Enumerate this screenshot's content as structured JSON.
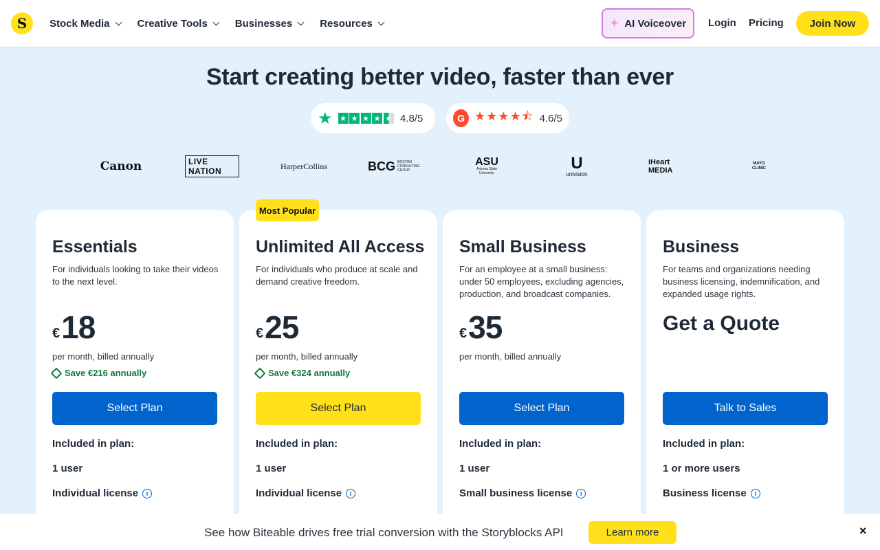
{
  "nav": {
    "logo": "S",
    "menu": [
      {
        "label": "Stock Media"
      },
      {
        "label": "Creative Tools"
      },
      {
        "label": "Businesses"
      },
      {
        "label": "Resources"
      }
    ],
    "ai_voiceover": "AI Voiceover",
    "login": "Login",
    "pricing": "Pricing",
    "join": "Join Now"
  },
  "hero": {
    "title": "Start creating better video, faster than ever",
    "trustpilot_score": "4.8/5",
    "g2_logo": "G",
    "g2_score": "4.6/5"
  },
  "logos": {
    "canon": "Canon",
    "livenation": "LIVE NATION",
    "harpercollins": "HarperCollins",
    "bcg": "BCG",
    "bcg_sub": "BOSTON CONSULTING GROUP",
    "asu": "ASU",
    "asu_sub": "Arizona State University",
    "univision_mark": "U",
    "univision": "univision",
    "iheart": "iHeart MEDIA",
    "mayo": "MAYO CLINIC"
  },
  "badge": "Most Popular",
  "plans": [
    {
      "name": "Essentials",
      "desc": "For individuals looking to take their videos to the next level.",
      "currency": "€",
      "amount": "18",
      "billing": "per month, billed annually",
      "save": "Save €216 annually",
      "cta": "Select Plan",
      "included": "Included in plan:",
      "users": "1 user",
      "license": "Individual license"
    },
    {
      "name": "Unlimited All Access",
      "desc": "For individuals who produce at scale and demand creative freedom.",
      "currency": "€",
      "amount": "25",
      "billing": "per month, billed annually",
      "save": "Save €324 annually",
      "cta": "Select Plan",
      "included": "Included in plan:",
      "users": "1 user",
      "license": "Individual license"
    },
    {
      "name": "Small Business",
      "desc": "For an employee at a small business: under 50 employees, excluding agencies, production, and broadcast companies.",
      "currency": "€",
      "amount": "35",
      "billing": "per month, billed annually",
      "cta": "Select Plan",
      "included": "Included in plan:",
      "users": "1 user",
      "license": "Small business license"
    },
    {
      "name": "Business",
      "desc": "For teams and organizations needing business licensing, indemnification, and expanded usage rights.",
      "quote": "Get a Quote",
      "cta": "Talk to Sales",
      "included": "Included in plan:",
      "users": "1 or more users",
      "license": "Business license"
    }
  ],
  "banner": {
    "text": "See how Biteable drives free trial conversion with the Storyblocks API",
    "cta": "Learn more",
    "close": "×"
  },
  "colors": {
    "accent_yellow": "#ffe01b",
    "cta_blue": "#0064cc",
    "page_bg": "#e3f1fc",
    "save_green": "#0e7a3a",
    "trustpilot_green": "#00b67a",
    "g2_red": "#ff492c"
  }
}
